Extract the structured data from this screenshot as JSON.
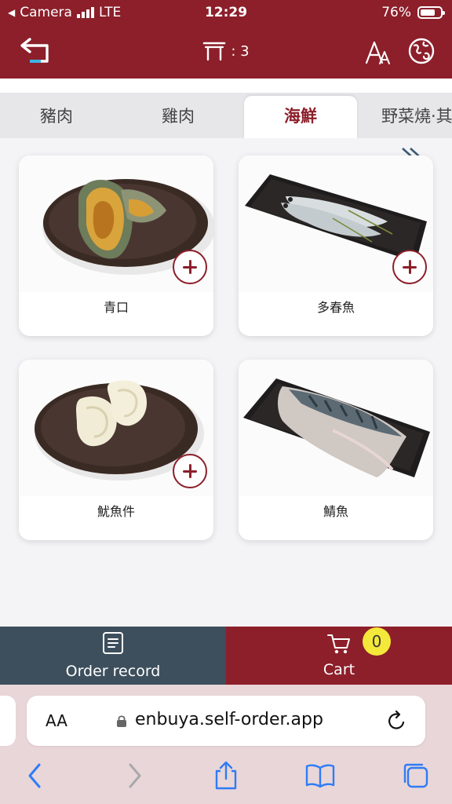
{
  "status_bar": {
    "back_app": "Camera",
    "network": "LTE",
    "time": "12:29",
    "battery": "76%",
    "battery_level": 0.76
  },
  "header": {
    "table_number": ": 3",
    "icons": [
      "back-arrow-icon",
      "table-icon",
      "font-size-icon",
      "language-icon"
    ]
  },
  "tabs": [
    {
      "label": "豬肉",
      "active": false
    },
    {
      "label": "雞肉",
      "active": false
    },
    {
      "label": "海鮮",
      "active": true
    },
    {
      "label": "野菜燒·其",
      "active": false
    }
  ],
  "items": [
    {
      "name": "青口",
      "has_add": true
    },
    {
      "name": "多春魚",
      "has_add": true
    },
    {
      "name": "魷魚件",
      "has_add": true
    },
    {
      "name": "鯖魚",
      "has_add": false
    }
  ],
  "bottom_bar": {
    "order_record_label": "Order record",
    "cart_label": "Cart",
    "cart_count": "0"
  },
  "browser": {
    "aa_label": "AA",
    "url": "enbuya.self-order.app"
  },
  "colors": {
    "brand": "#8c1f2a",
    "order_bar": "#3d4f5c",
    "badge": "#f4e83a"
  }
}
